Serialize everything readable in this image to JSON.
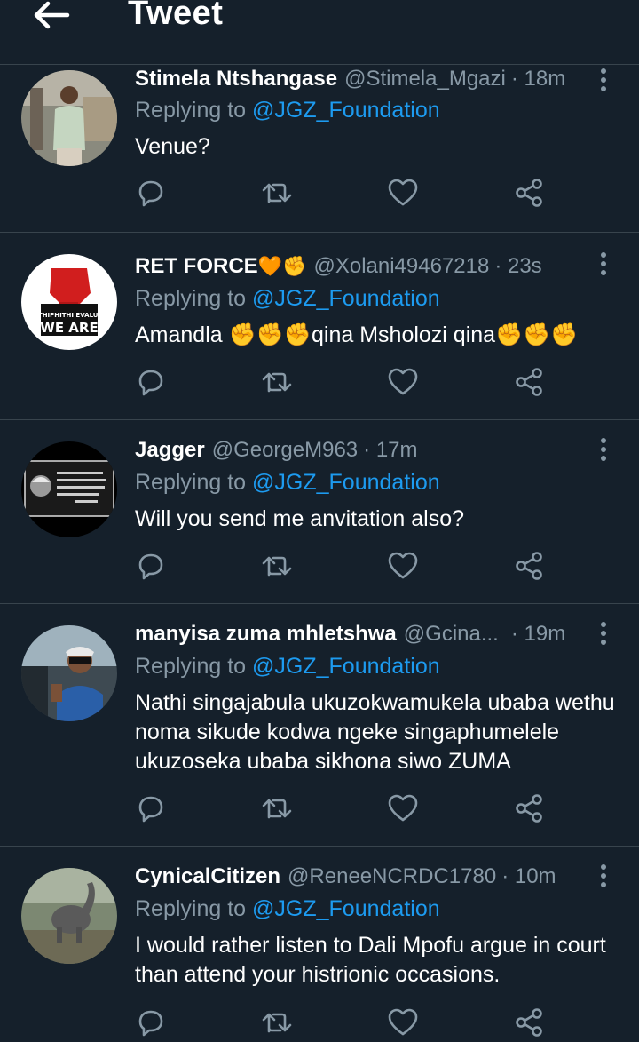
{
  "header": {
    "title": "Tweet",
    "back_icon": "arrow-left-icon"
  },
  "replying_label": "Replying to",
  "tweets": [
    {
      "name": "Stimela Ntshangase",
      "name_emoji": "",
      "handle": "@Stimela_Mgazi",
      "time": "· 18m",
      "mention": "@JGZ_Foundation",
      "lines": [
        "Venue?"
      ]
    },
    {
      "name": "RET FORCE",
      "name_emoji": "🧡✊",
      "handle": "@Xolani49467218",
      "time": "· 23s",
      "mention": "@JGZ_Foundation",
      "lines": [
        "Amandla ✊✊✊qina Msholozi qina✊✊✊"
      ],
      "avatar_text": [
        "SPRITHIPHITHI EVALUATOR",
        "WE ARE"
      ]
    },
    {
      "name": "Jagger",
      "name_emoji": "",
      "handle": "@GeorgeM963",
      "time": "· 17m",
      "mention": "@JGZ_Foundation",
      "lines": [
        "Will you send me anvitation also?"
      ]
    },
    {
      "name": "manyisa zuma mhletshwa",
      "name_emoji": "",
      "handle": "@Gcina...",
      "time": "· 19m",
      "mention": "@JGZ_Foundation",
      "lines": [
        "Nathi singajabula ukuzokwamukela ubaba wethu",
        "noma sikude kodwa ngeke singaphumelele",
        "ukuzoseka ubaba sikhona siwo ZUMA"
      ]
    },
    {
      "name": "CynicalCitizen",
      "name_emoji": "",
      "handle": "@ReneeNCRDC1780",
      "time": "· 10m",
      "mention": "@JGZ_Foundation",
      "lines": [
        "I would rather listen to Dali Mpofu argue in court",
        "than attend your histrionic occasions."
      ]
    }
  ],
  "action_icons": [
    "reply-icon",
    "retweet-icon",
    "like-icon",
    "share-icon"
  ],
  "colors": {
    "background": "#15202b",
    "divider": "#38444d",
    "secondary": "#8899a6",
    "accent": "#1d9bf0"
  }
}
